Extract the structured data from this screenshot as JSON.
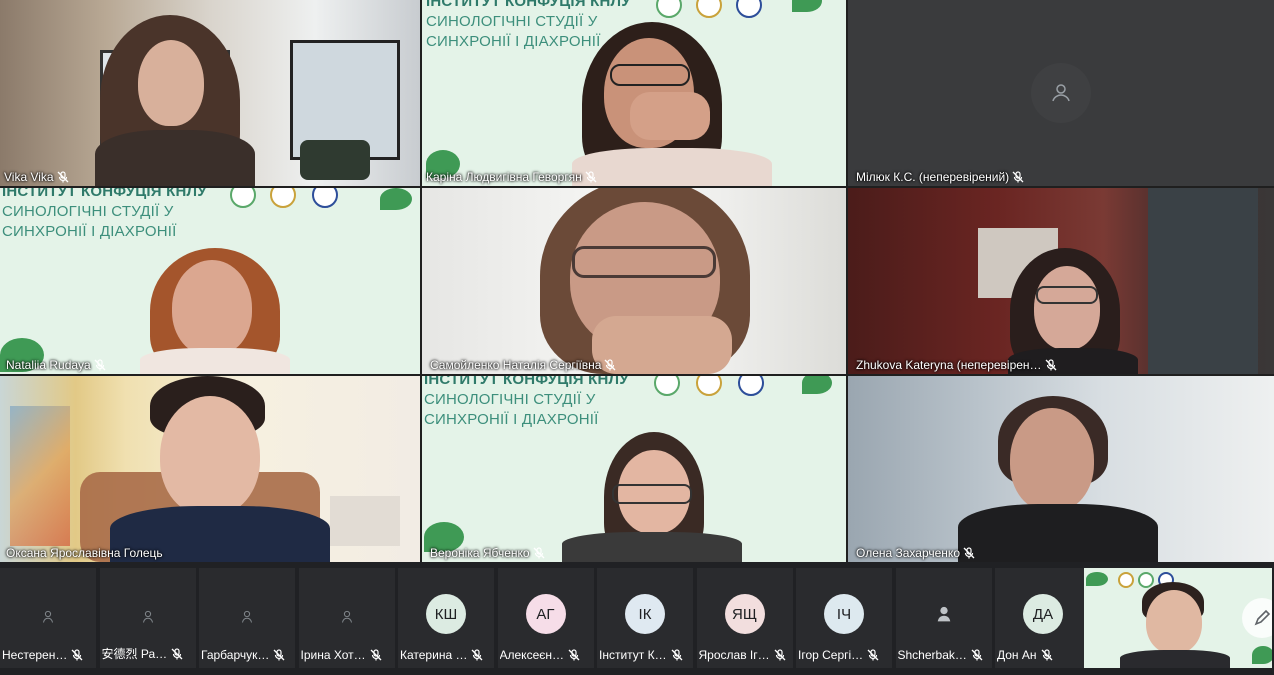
{
  "tiles": [
    {
      "name": "Vika Vika"
    },
    {
      "name": "Каріна Людвигівна Геворгян"
    },
    {
      "name": "Мілюк К.С. (неперевірений)"
    },
    {
      "name": "Nataliia Rudaya"
    },
    {
      "name": "Самойленко Наталія Сергіївна"
    },
    {
      "name": "Zhukova Kateryna (неперевірен…"
    },
    {
      "name": "Оксана Ярославівна Голець"
    },
    {
      "name": "Вероніка Ябченко"
    },
    {
      "name": "Олена Захарченко"
    }
  ],
  "slides": {
    "title": "ІНСТИТУТ КОНФУЦІЯ КНЛУ",
    "line1": "СИНОЛОГІЧНІ СТУДІЇ У",
    "line2": "СИНХРОНІЇ І ДІАХРОНІЇ"
  },
  "strip": [
    {
      "name": "Нестерен…",
      "initials": ""
    },
    {
      "name": "安德烈 Ра…",
      "initials": ""
    },
    {
      "name": "Гарбарчук…",
      "initials": ""
    },
    {
      "name": "Ірина Хот…",
      "initials": ""
    },
    {
      "name": "Катерина …",
      "initials": "КШ"
    },
    {
      "name": "Алексеєн…",
      "initials": "АГ"
    },
    {
      "name": "Інститут К…",
      "initials": "ІК"
    },
    {
      "name": "Ярослав Іг…",
      "initials": "ЯЩ"
    },
    {
      "name": "Ігор Сергі…",
      "initials": "ІЧ"
    },
    {
      "name": "Shcherbak…",
      "initials": ""
    },
    {
      "name": "Дон Ан",
      "initials": "ДА"
    }
  ],
  "colors": {
    "speaking_outline": "#8ab4f8",
    "slide_green": "#2f7a6a",
    "stage_bg": "#1f1f1f"
  },
  "icons": [
    "mic-muted-icon",
    "person-placeholder-icon",
    "pen-icon"
  ]
}
